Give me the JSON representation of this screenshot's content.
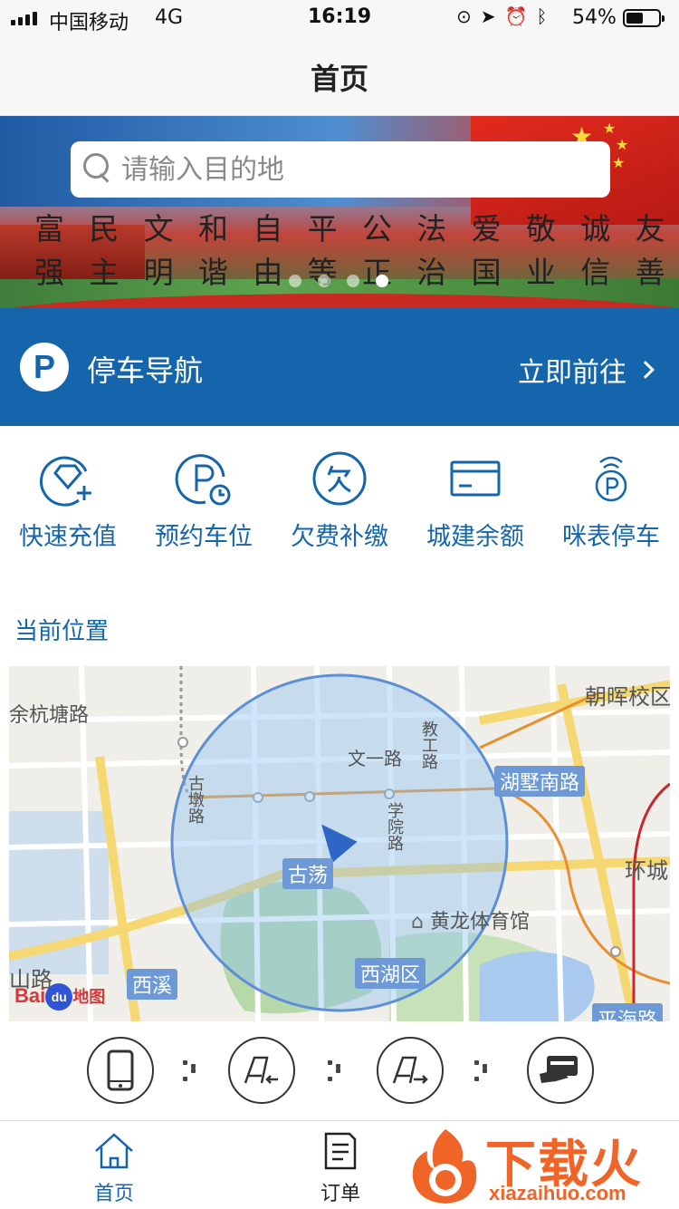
{
  "status_bar": {
    "carrier": "中国移动",
    "network": "4G",
    "time": "16:19",
    "battery_percent": "54%",
    "battery_level": 0.54
  },
  "nav": {
    "title": "首页"
  },
  "search": {
    "placeholder": "请输入目的地"
  },
  "banner": {
    "slogans": [
      "富强",
      "民主",
      "文明",
      "和谐",
      "自由",
      "平等",
      "公正",
      "法治",
      "爱国",
      "敬业",
      "诚信",
      "友善"
    ],
    "page_count": 4,
    "active_page": 4
  },
  "parking_nav": {
    "badge": "P",
    "label": "停车导航",
    "action": "立即前往"
  },
  "quick_actions": [
    {
      "label": "快速充值",
      "icon": "diamond-plus-icon"
    },
    {
      "label": "预约车位",
      "icon": "parking-clock-icon"
    },
    {
      "label": "欠费补缴",
      "icon": "arrears-icon"
    },
    {
      "label": "城建余额",
      "icon": "card-icon"
    },
    {
      "label": "咪表停车",
      "icon": "parking-meter-icon"
    }
  ],
  "location": {
    "title": "当前位置"
  },
  "map": {
    "labels": {
      "hangtang": "余杭塘路",
      "zhaohui": "朝晖校区",
      "wenyi": "文一路",
      "jiaogong": "教工路",
      "hushunan": "湖墅南路",
      "gudun": "古墩路",
      "xueyuan": "学院路",
      "huancheng": "环城",
      "gudang": "古荡",
      "huanglong": "黄龙体育馆",
      "shan": "山路",
      "xixi": "西溪",
      "xihu": "西湖区",
      "pinghai": "平海路"
    },
    "logo": {
      "bai": "Bai",
      "du": "du",
      "tu": "地图"
    }
  },
  "tabs": {
    "home": "首页",
    "orders": "订单"
  },
  "watermark": {
    "brand": "下载火",
    "url": "xiazaihuo.com"
  }
}
